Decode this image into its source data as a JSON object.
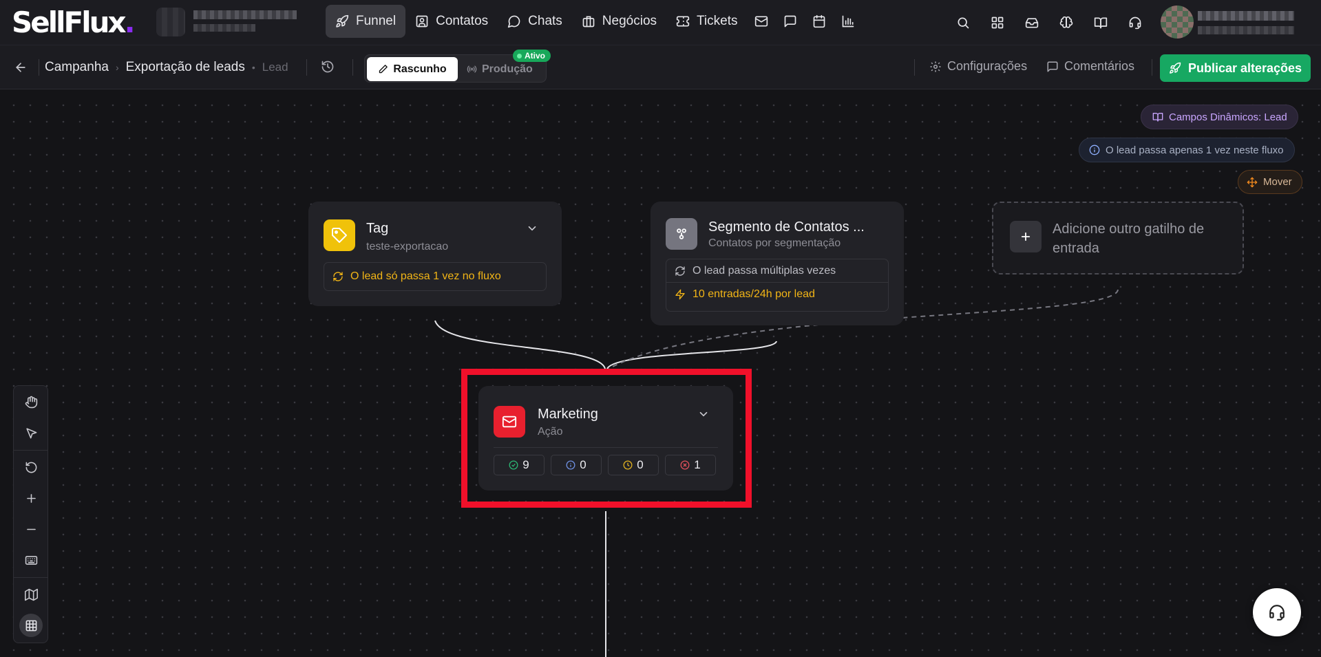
{
  "brand": {
    "logo": "SellFlux",
    "accent": "#8a2cf0"
  },
  "nav": {
    "funnel": "Funnel",
    "contacts": "Contatos",
    "chats": "Chats",
    "deals": "Negócios",
    "tickets": "Tickets"
  },
  "breadcrumb": {
    "campaign": "Campanha",
    "flow": "Exportação de leads",
    "type": "Lead"
  },
  "modes": {
    "draft": "Rascunho",
    "production": "Produção",
    "status_badge": "Ativo"
  },
  "actions": {
    "settings": "Configurações",
    "comments": "Comentários",
    "publish": "Publicar alterações"
  },
  "canvas_chips": {
    "dynamic_fields": "Campos Dinâmicos: Lead",
    "once_info": "O lead passa apenas 1 vez neste fluxo",
    "move": "Mover"
  },
  "nodes": {
    "tag": {
      "title": "Tag",
      "subtitle": "teste-exportacao",
      "rule": "O lead só passa 1 vez no fluxo",
      "icon_color": "#f0c20a"
    },
    "segment": {
      "title": "Segmento de Contatos ...",
      "subtitle": "Contatos por segmentação",
      "rule1": "O lead passa múltiplas vezes",
      "rule2": "10 entradas/24h por lead",
      "icon_color": "#75757f"
    },
    "add_trigger": {
      "text": "Adicione outro gatilho de entrada"
    },
    "marketing": {
      "title": "Marketing",
      "subtitle": "Ação",
      "icon_color": "#e8202e",
      "stats": {
        "success": "9",
        "info": "0",
        "pending": "0",
        "error": "1"
      }
    }
  },
  "colors": {
    "publish": "#17a862",
    "highlight": "#f0102a",
    "warning_text": "#f2b516"
  }
}
